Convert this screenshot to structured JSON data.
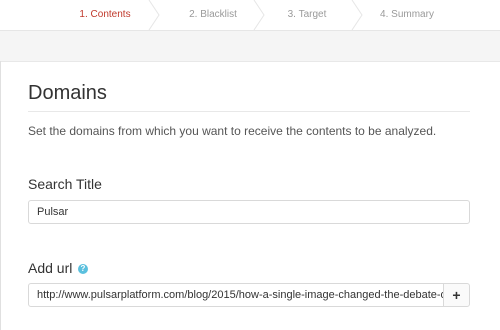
{
  "wizard": {
    "steps": [
      {
        "label": "1. Contents"
      },
      {
        "label": "2. Blacklist"
      },
      {
        "label": "3. Target"
      },
      {
        "label": "4. Summary"
      }
    ],
    "active_color": "#c0392b",
    "inactive_color": "#9a9a9a"
  },
  "section": {
    "title": "Domains",
    "description": "Set the domains from which you want to receive the contents to be analyzed."
  },
  "search_title": {
    "label": "Search Title",
    "value": "Pulsar"
  },
  "add_url": {
    "label": "Add url",
    "help_icon": "question-circle-icon",
    "value": "http://www.pulsarplatform.com/blog/2015/how-a-single-image-changed-the-debate-o",
    "add_button_icon": "plus-icon",
    "add_button_label": "+"
  }
}
